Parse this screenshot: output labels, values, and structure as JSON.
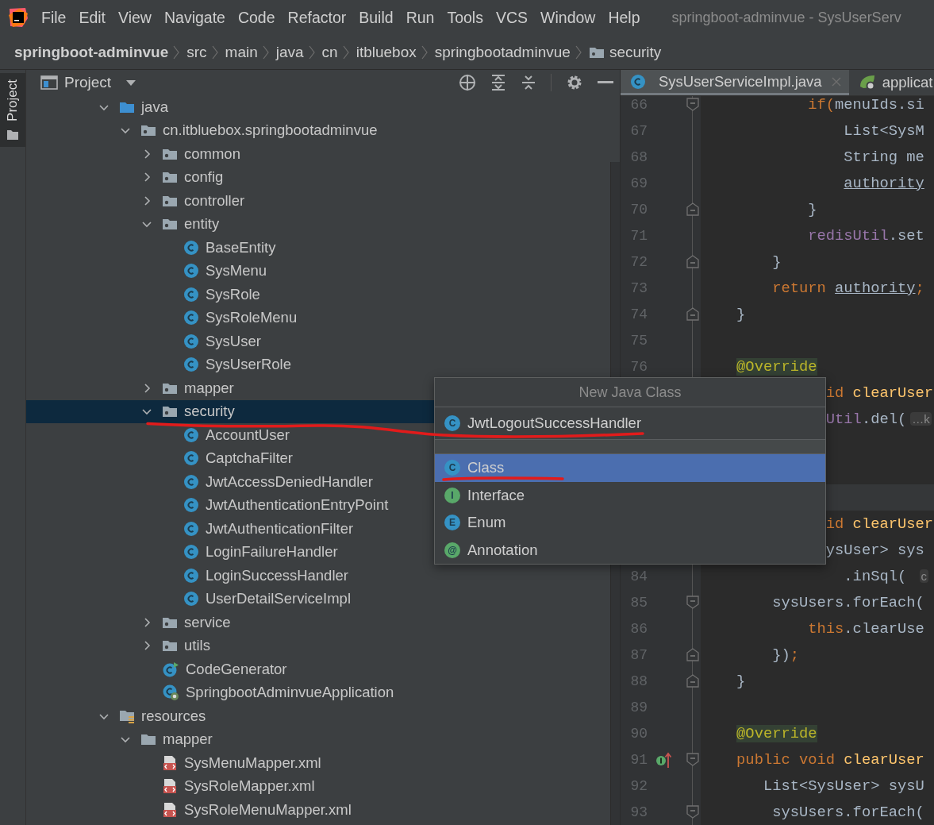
{
  "menu_bar": {
    "items": [
      "File",
      "Edit",
      "View",
      "Navigate",
      "Code",
      "Refactor",
      "Build",
      "Run",
      "Tools",
      "VCS",
      "Window",
      "Help"
    ],
    "title": "springboot-adminvue - SysUserServ"
  },
  "breadcrumb": [
    {
      "label": "springboot-adminvue",
      "kind": "project"
    },
    {
      "label": "src",
      "kind": "dir"
    },
    {
      "label": "main",
      "kind": "dir"
    },
    {
      "label": "java",
      "kind": "dir"
    },
    {
      "label": "cn",
      "kind": "dir"
    },
    {
      "label": "itbluebox",
      "kind": "dir"
    },
    {
      "label": "springbootadminvue",
      "kind": "dir"
    },
    {
      "label": "security",
      "kind": "folder"
    }
  ],
  "tool_strip": {
    "label": "Project",
    "selected": true
  },
  "project_panel": {
    "title": "Project",
    "tree": [
      {
        "label": "java",
        "kind": "source-folder",
        "expanded": true,
        "selected": false,
        "children": [
          {
            "label": "cn.itbluebox.springbootadminvue",
            "kind": "package",
            "expanded": true,
            "selected": false,
            "children": [
              {
                "label": "common",
                "kind": "package",
                "expanded": false,
                "selected": false
              },
              {
                "label": "config",
                "kind": "package",
                "expanded": false,
                "selected": false
              },
              {
                "label": "controller",
                "kind": "package",
                "expanded": false,
                "selected": false
              },
              {
                "label": "entity",
                "kind": "package",
                "expanded": true,
                "selected": false,
                "children": [
                  {
                    "label": "BaseEntity",
                    "kind": "class",
                    "selected": false
                  },
                  {
                    "label": "SysMenu",
                    "kind": "class",
                    "selected": false
                  },
                  {
                    "label": "SysRole",
                    "kind": "class",
                    "selected": false
                  },
                  {
                    "label": "SysRoleMenu",
                    "kind": "class",
                    "selected": false
                  },
                  {
                    "label": "SysUser",
                    "kind": "class",
                    "selected": false
                  },
                  {
                    "label": "SysUserRole",
                    "kind": "class",
                    "selected": false
                  }
                ]
              },
              {
                "label": "mapper",
                "kind": "package",
                "expanded": false,
                "selected": false
              },
              {
                "label": "security",
                "kind": "package",
                "expanded": true,
                "selected": true,
                "children": [
                  {
                    "label": "AccountUser",
                    "kind": "class",
                    "selected": false
                  },
                  {
                    "label": "CaptchaFilter",
                    "kind": "class",
                    "selected": false
                  },
                  {
                    "label": "JwtAccessDeniedHandler",
                    "kind": "class",
                    "selected": false
                  },
                  {
                    "label": "JwtAuthenticationEntryPoint",
                    "kind": "class",
                    "selected": false
                  },
                  {
                    "label": "JwtAuthenticationFilter",
                    "kind": "class",
                    "selected": false
                  },
                  {
                    "label": "LoginFailureHandler",
                    "kind": "class",
                    "selected": false
                  },
                  {
                    "label": "LoginSuccessHandler",
                    "kind": "class",
                    "selected": false
                  },
                  {
                    "label": "UserDetailServiceImpl",
                    "kind": "class",
                    "selected": false
                  }
                ]
              },
              {
                "label": "service",
                "kind": "package",
                "expanded": false,
                "selected": false
              },
              {
                "label": "utils",
                "kind": "package",
                "expanded": false,
                "selected": false
              },
              {
                "label": "CodeGenerator",
                "kind": "runnable-class",
                "selected": false
              },
              {
                "label": "SpringbootAdminvueApplication",
                "kind": "spring-app",
                "selected": false
              }
            ]
          }
        ]
      },
      {
        "label": "resources",
        "kind": "resources",
        "expanded": true,
        "selected": false,
        "children": [
          {
            "label": "mapper",
            "kind": "folder",
            "expanded": true,
            "selected": false,
            "children": [
              {
                "label": "SysMenuMapper.xml",
                "kind": "xml",
                "selected": false
              },
              {
                "label": "SysRoleMapper.xml",
                "kind": "xml",
                "selected": false
              },
              {
                "label": "SysRoleMenuMapper.xml",
                "kind": "xml",
                "selected": false
              }
            ]
          }
        ]
      }
    ]
  },
  "editor": {
    "tabs": [
      {
        "label": "SysUserServiceImpl.java",
        "kind": "class",
        "selected": true,
        "closable": true
      },
      {
        "label": "applicat",
        "kind": "spring",
        "selected": false,
        "closable": false
      }
    ],
    "lines": [
      {
        "number": "66",
        "fold_start": true,
        "fold_end": false,
        "tokens": [
          {
            "t": "            if(",
            "kind": "keyword"
          },
          {
            "t": "menuIds.si",
            "kind": "plain"
          }
        ]
      },
      {
        "number": "67",
        "fold_start": false,
        "fold_end": false,
        "tokens": [
          {
            "t": "                List<SysM",
            "kind": "plain"
          }
        ]
      },
      {
        "number": "68",
        "fold_start": false,
        "fold_end": false,
        "tokens": [
          {
            "t": "                String me",
            "kind": "plain"
          }
        ]
      },
      {
        "number": "69",
        "fold_start": false,
        "fold_end": false,
        "tokens": [
          {
            "t": "                authority",
            "kind": "ref"
          }
        ]
      },
      {
        "number": "70",
        "fold_start": false,
        "fold_end": true,
        "tokens": [
          {
            "t": "            }",
            "kind": "plain"
          }
        ]
      },
      {
        "number": "71",
        "fold_start": false,
        "fold_end": false,
        "tokens": [
          {
            "t": "            redisUtil",
            "kind": "field"
          },
          {
            "t": ".set",
            "kind": "plain"
          }
        ]
      },
      {
        "number": "72",
        "fold_start": false,
        "fold_end": true,
        "tokens": [
          {
            "t": "        }",
            "kind": "plain"
          }
        ]
      },
      {
        "number": "73",
        "fold_start": false,
        "fold_end": false,
        "tokens": [
          {
            "t": "        return ",
            "kind": "keyword"
          },
          {
            "t": "authority",
            "kind": "ref"
          },
          {
            "t": ";",
            "kind": "keyword"
          }
        ]
      },
      {
        "number": "74",
        "fold_start": false,
        "fold_end": true,
        "tokens": [
          {
            "t": "    }",
            "kind": "plain"
          }
        ]
      },
      {
        "number": "75",
        "fold_start": false,
        "fold_end": false
      },
      {
        "number": "76",
        "fold_start": false,
        "fold_end": false,
        "tokens": [
          {
            "t": "    @Override",
            "kind": "annotation"
          }
        ]
      },
      {
        "tokens": [
          {
            "t": "              id ",
            "kind": "keyword"
          },
          {
            "t": "clearUser",
            "kind": "method"
          }
        ]
      },
      {
        "tokens": [
          {
            "t": "              Util",
            "kind": "field"
          },
          {
            "t": ".del(",
            "kind": "plain"
          },
          {
            "t": "…k",
            "kind": "folded"
          }
        ]
      },
      {
        "kind": "blank"
      },
      {
        "kind": "blank"
      },
      {
        "kind": "separator"
      },
      {
        "tokens": [
          {
            "t": "              id ",
            "kind": "keyword"
          },
          {
            "t": "clearUser",
            "kind": "method"
          }
        ]
      },
      {
        "tokens": [
          {
            "t": "              ysUser> sys",
            "kind": "plain"
          }
        ]
      },
      {
        "number": "84",
        "fold_start": false,
        "fold_end": false,
        "tokens": [
          {
            "t": "                .inSql( ",
            "kind": "plain"
          },
          {
            "t": "c",
            "kind": "folded"
          }
        ]
      },
      {
        "number": "85",
        "fold_start": true,
        "fold_end": false,
        "tokens": [
          {
            "t": "        sysUsers.forEach(",
            "kind": "plain"
          }
        ]
      },
      {
        "number": "86",
        "fold_start": false,
        "fold_end": false,
        "tokens": [
          {
            "t": "            this",
            "kind": "keyword"
          },
          {
            "t": ".clearUse",
            "kind": "plain"
          }
        ]
      },
      {
        "number": "87",
        "fold_start": false,
        "fold_end": true,
        "tokens": [
          {
            "t": "        })",
            "kind": "plain"
          },
          {
            "t": ";",
            "kind": "keyword"
          }
        ]
      },
      {
        "number": "88",
        "fold_start": false,
        "fold_end": true,
        "tokens": [
          {
            "t": "    }",
            "kind": "plain"
          }
        ]
      },
      {
        "number": "89",
        "fold_start": false,
        "fold_end": false
      },
      {
        "number": "90",
        "fold_start": false,
        "fold_end": false,
        "tokens": [
          {
            "t": "    @Override",
            "kind": "annotation"
          }
        ]
      },
      {
        "number": "91",
        "fold_start": true,
        "fold_end": false,
        "gutter_icon": {
          "kind": "implements"
        },
        "tokens": [
          {
            "t": "    public void ",
            "kind": "keyword"
          },
          {
            "t": "clearUser",
            "kind": "method"
          }
        ]
      },
      {
        "number": "92",
        "fold_start": false,
        "fold_end": false,
        "tokens": [
          {
            "t": "       List<SysUser> sysU",
            "kind": "plain"
          }
        ]
      },
      {
        "number": "93",
        "fold_start": true,
        "fold_end": false,
        "tokens": [
          {
            "t": "        sysUsers.forEach(",
            "kind": "plain"
          }
        ]
      }
    ]
  },
  "popup": {
    "title": "New Java Class",
    "field": {
      "badge": "C",
      "value": "JwtLogoutSuccessHandler"
    },
    "items": [
      {
        "badge": "C",
        "label": "Class",
        "kind": "class",
        "selected": true
      },
      {
        "badge": "I",
        "label": "Interface",
        "kind": "interface",
        "selected": false
      },
      {
        "badge": "E",
        "label": "Enum",
        "kind": "enum",
        "selected": false
      },
      {
        "badge": "@",
        "label": "Annotation",
        "kind": "annotation",
        "selected": false
      }
    ]
  }
}
